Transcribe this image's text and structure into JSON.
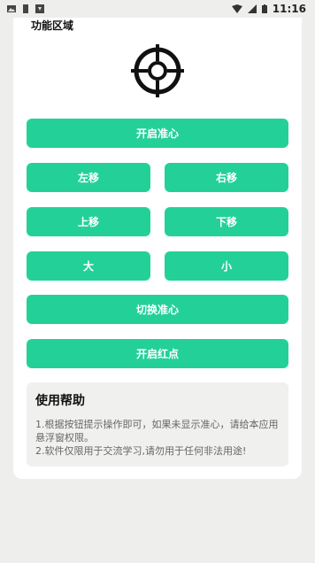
{
  "status": {
    "time": "11:16"
  },
  "section": {
    "title": "功能区域"
  },
  "buttons": {
    "open_crosshair": "开启准心",
    "move_left": "左移",
    "move_right": "右移",
    "move_up": "上移",
    "move_down": "下移",
    "bigger": "大",
    "smaller": "小",
    "switch_crosshair": "切换准心",
    "open_red_dot": "开启红点"
  },
  "help": {
    "title": "使用帮助",
    "line1": "1.根据按钮提示操作即可，如果未显示准心，请给本应用悬浮窗权限。",
    "line2": "2.软件仅限用于交流学习,请勿用于任何非法用途!"
  },
  "colors": {
    "accent": "#23d198",
    "background": "#eeefec",
    "card": "#ffffff"
  },
  "icons": {
    "crosshair": "crosshair-icon"
  }
}
